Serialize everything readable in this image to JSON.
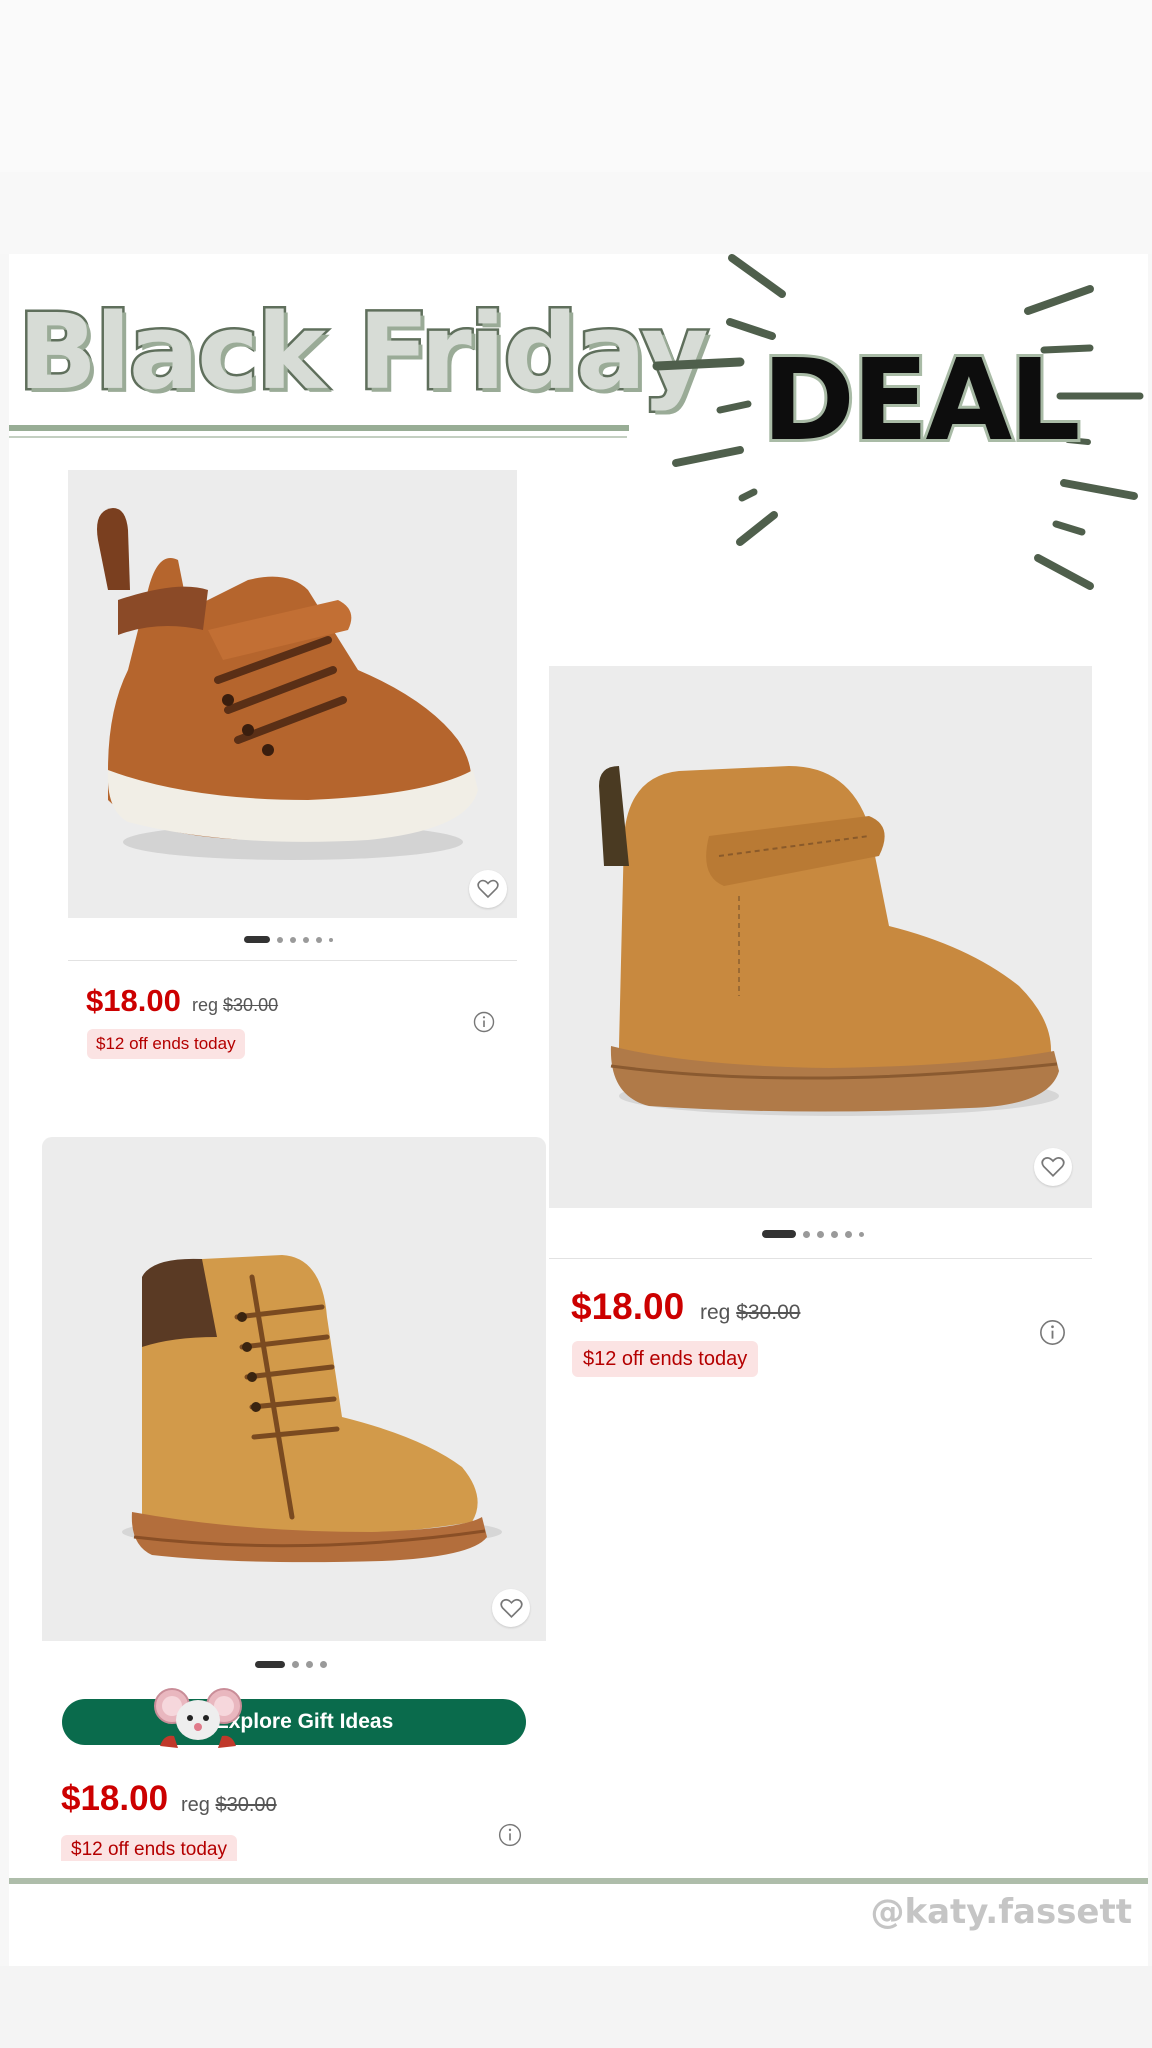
{
  "header": {
    "title": "Black Friday",
    "deal": "DEAL"
  },
  "products": [
    {
      "name": "brown-high-top-sneaker",
      "price": "$18.00",
      "reg_label": "reg",
      "reg_price": "$30.00",
      "promo": "$12 off ends today",
      "image_count": 6
    },
    {
      "name": "tan-suede-chukka-boot",
      "price": "$18.00",
      "reg_label": "reg",
      "reg_price": "$30.00",
      "promo": "$12 off ends today",
      "image_count": 6
    },
    {
      "name": "wheat-lace-up-boot",
      "price": "$18.00",
      "reg_label": "reg",
      "reg_price": "$30.00",
      "promo": "$12 off ends today",
      "image_count": 4
    }
  ],
  "gift_button": {
    "label": "Explore Gift Ideas"
  },
  "footer": {
    "handle": "@katy.fassett"
  },
  "colors": {
    "price_red": "#cc0000",
    "promo_bg": "#fbe3e3",
    "gift_green": "#0a6b4c",
    "accent_sage": "#5f6f5c"
  },
  "icons": [
    "heart-icon",
    "info-icon",
    "mouse-mascot-icon",
    "burst-icon"
  ]
}
